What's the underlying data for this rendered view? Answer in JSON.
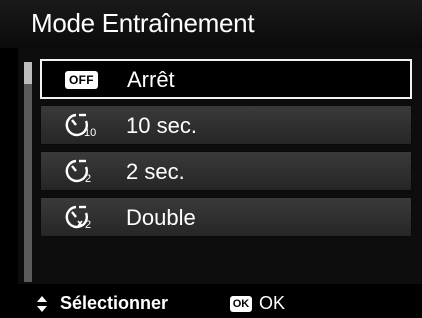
{
  "title": "Mode Entraînement",
  "menu": {
    "items": [
      {
        "icon": "self-timer-off-icon",
        "badge": "OFF",
        "label": "Arrêt",
        "selected": true
      },
      {
        "icon": "self-timer-10s-icon",
        "label": "10 sec.",
        "selected": false
      },
      {
        "icon": "self-timer-2s-icon",
        "label": "2 sec.",
        "selected": false
      },
      {
        "icon": "self-timer-double-icon",
        "label": "Double",
        "selected": false
      }
    ]
  },
  "footer": {
    "select_icon": "up-down-arrows-icon",
    "select_label": "Sélectionner",
    "ok_badge": "OK",
    "ok_label": "OK"
  }
}
